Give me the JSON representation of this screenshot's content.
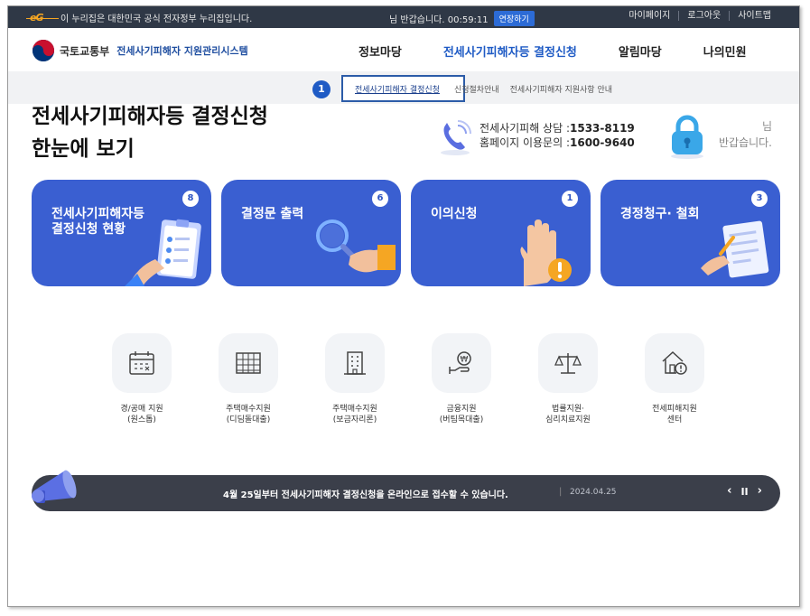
{
  "govbar": {
    "logo_text": "eG",
    "notice": "이 누리집은 대한민국 공식 전자정부 누리집입니다.",
    "session": "님 반갑습니다. 00:59:11",
    "extend_label": "연장하기",
    "links": [
      "마이페이지",
      "로그아웃",
      "사이트맵"
    ]
  },
  "header": {
    "ministry": "국토교통부",
    "system": "전세사기피해자 지원관리시스템",
    "nav": [
      "정보마당",
      "전세사기피해자등 결정신청",
      "알림마당",
      "나의민원"
    ]
  },
  "subnav": {
    "step": "1",
    "links": [
      "전세사기피해자 결정신청",
      "신청절차안내",
      "전세사기피해자 지원사항 안내"
    ]
  },
  "page": {
    "title_line1": "전세사기피해자등 결정신청",
    "title_line2": "한눈에 보기"
  },
  "contact": {
    "line1_label": "전세사기피해 상담 :",
    "line1_number": "1533-8119",
    "line2_label": "홈페이지 이용문의 :",
    "line2_number": "1600-9640"
  },
  "greeting": {
    "line1": "님",
    "line2": "반갑습니다."
  },
  "cards": [
    {
      "title": "전세사기피해자등\n결정신청 현황",
      "count": "8"
    },
    {
      "title": "결정문 출력",
      "count": "6"
    },
    {
      "title": "이의신청",
      "count": "1"
    },
    {
      "title": "경정청구· 철회",
      "count": "3"
    }
  ],
  "services": [
    {
      "label": "경/공매 지원\n(원스톱)",
      "icon": "calendar-icon"
    },
    {
      "label": "주택매수지원\n(디딤돌대출)",
      "icon": "building-icon"
    },
    {
      "label": "주택매수지원\n(보금자리론)",
      "icon": "office-icon"
    },
    {
      "label": "금융지원\n(버팀목대출)",
      "icon": "won-hand-icon"
    },
    {
      "label": "법률지원·\n심리치료지원",
      "icon": "scale-icon"
    },
    {
      "label": "전세피해지원\n센터",
      "icon": "house-alert-icon"
    }
  ],
  "notice": {
    "text": "4월 25일부터 전세사기피해자 결정신청을 온라인으로 접수할 수 있습니다.",
    "separator": "|",
    "date": "2024.04.25",
    "prev": "‹",
    "pause": "II",
    "next": "›"
  },
  "colors": {
    "accent": "#1f5bc5",
    "card_bg": "#3a5fd1",
    "govbar_bg": "#2f3846",
    "notice_bg": "#3b3f4a"
  }
}
